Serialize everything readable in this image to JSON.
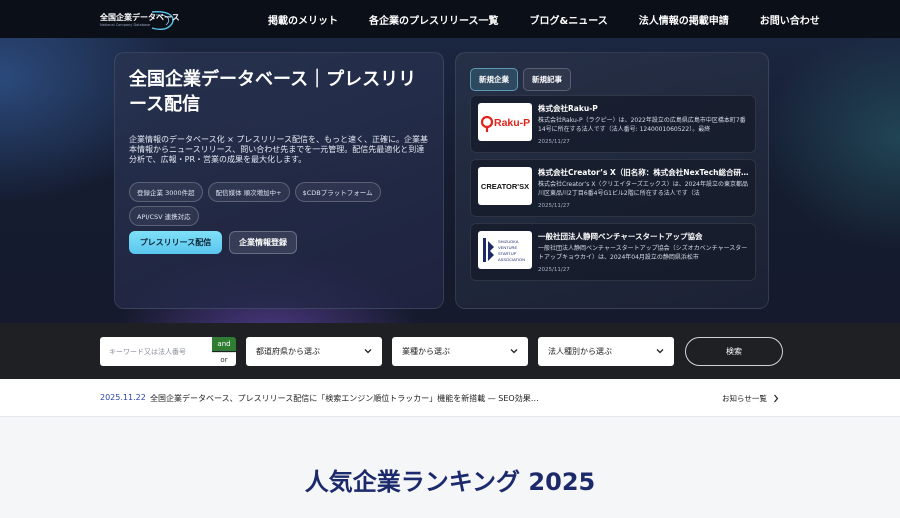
{
  "header": {
    "logo_jp": "全国企業データベース",
    "logo_en": "National Company Database",
    "nav": [
      "掲載のメリット",
      "各企業のプレスリリース一覧",
      "ブログ&ニュース",
      "法人情報の掲載申請",
      "お問い合わせ"
    ]
  },
  "hero": {
    "title": "全国企業データベース｜プレスリリース配信",
    "description": "企業情報のデータベース化 × プレスリリース配信を、もっと速く、正確に。企業基本情報からニュースリリース、問い合わせ先までを一元管理。配信先最適化と到達分析で、広報・PR・営業の成果を最大化します。",
    "tags": [
      "登録企業 3000件超",
      "配信媒体 順次増加中+",
      "$CDBプラットフォーム",
      "API/CSV 連携対応"
    ],
    "primary_button": "プレスリリース配信",
    "secondary_button": "企業情報登録"
  },
  "news": {
    "tabs": [
      "新規企業",
      "新規記事"
    ],
    "items": [
      {
        "name": "株式会社Raku-P",
        "text": "株式会社Raku-P（ラクピー）は、2022年設立の広島県広島市中区橋本町7番14号に所在する法人です（法人番号: 1240001060522）。最終",
        "date": "2025/11/27",
        "logo": "Raku-P"
      },
      {
        "name": "株式会社Creator’s X（旧名称：株式会社NexTech総合研…",
        "text": "株式会社Creator’s X（クリエイターズエックス）は、2024年設立の東京都品川区東品川2丁目6番4号G1ビル2階に所在する法人です（法",
        "date": "2025/11/27",
        "logo": "CREATOR'SX"
      },
      {
        "name": "一般社団法人静岡ベンチャースタートアップ協会",
        "text": "一般社団法人静岡ベンチャースタートアップ協会（シズオカベンチャースタートアップキョウカイ）は、2024年04月設立の静岡県浜松市",
        "date": "2025/11/27",
        "logo_lines": [
          "SHIZUOKA",
          "VENTURE",
          "STARTUP",
          "ASSOCIATION"
        ]
      }
    ]
  },
  "search": {
    "keyword_placeholder": "キーワード又は法人番号",
    "and_label": "and",
    "or_label": "or",
    "prefecture": "都道府県から選ぶ",
    "industry": "業種から選ぶ",
    "corp_type": "法人種別から選ぶ",
    "button": "検索"
  },
  "announcement": {
    "date": "2025.11.22",
    "text": "全国企業データベース、プレスリリース配信に「検索エンジン順位トラッカー」機能を新搭載 — SEO効果…",
    "more": "お知らせ一覧"
  },
  "ranking": {
    "title": "人気企業ランキング 2025"
  },
  "colors": {
    "accent": "#5ac6ee",
    "brand_navy": "#1c2a6b",
    "and_green": "#2e7d32",
    "raku_red": "#e2231a"
  }
}
